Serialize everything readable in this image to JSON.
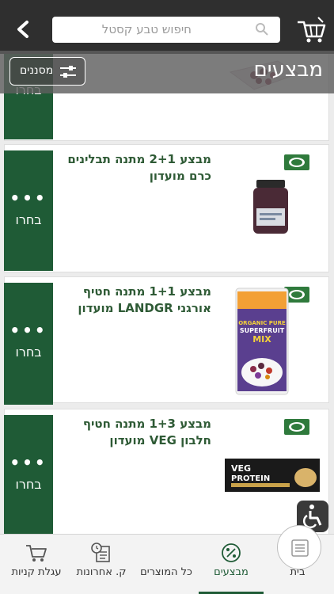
{
  "header": {
    "search_placeholder": "חיפוש טבע קסטל"
  },
  "titlebar": {
    "title": "מבצעים",
    "filters_label": "מסננים"
  },
  "products": [
    {
      "name": "",
      "choose_label": "בחרו",
      "dots": ""
    },
    {
      "name": "מבצע 2+1 מתנה תבלינים כרם מועדון",
      "choose_label": "בחרו",
      "dots": "•••"
    },
    {
      "name": "מבצע 1+1 מתנה חטיף אורגני LANDGR מועדון",
      "choose_label": "בחרו",
      "dots": "•••"
    },
    {
      "name": "מבצע 1+3 מתנה חטיף חלבון VEG מועדון",
      "choose_label": "בחרו",
      "dots": "•••"
    }
  ],
  "product_images": {
    "p3_line1": "ORGANIC PURE",
    "p3_line2": "SUPERFRUIT",
    "p3_line3": "MIX",
    "p4_line1": "VEG",
    "p4_line2": "PROTEIN"
  },
  "bottom_nav": [
    {
      "label": "בית",
      "icon": "home-icon"
    },
    {
      "label": "מבצעים",
      "icon": "percent-icon"
    },
    {
      "label": "כל המוצרים",
      "icon": "list-icon"
    },
    {
      "label": "ק. אחרונות",
      "icon": "history-icon"
    },
    {
      "label": "עגלת קניות",
      "icon": "cart-icon"
    }
  ],
  "colors": {
    "brand_green": "#1f5b36",
    "text_green": "#2e5a35",
    "topbar": "#2f2f2f"
  }
}
